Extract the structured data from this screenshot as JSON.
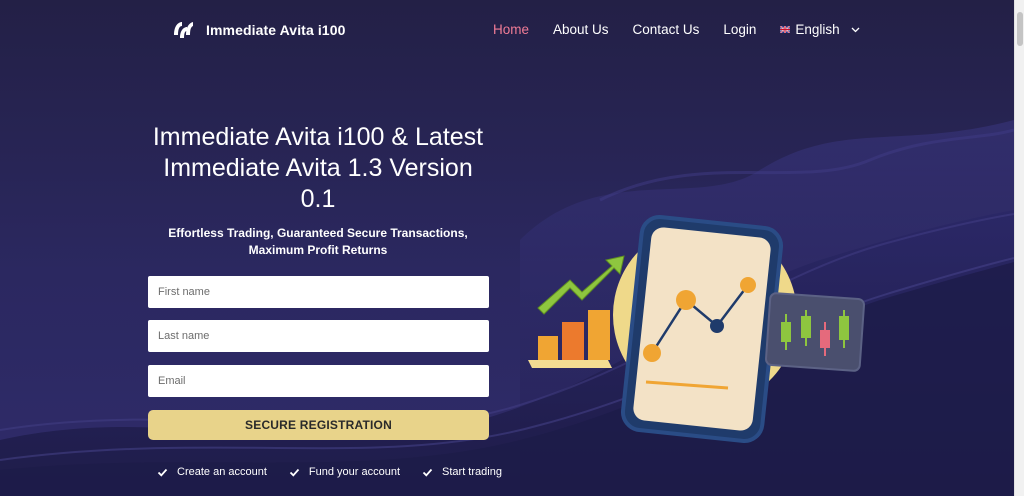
{
  "header": {
    "logo_text": "Immediate Avita i100",
    "nav": [
      {
        "label": "Home",
        "active": true
      },
      {
        "label": "About Us",
        "active": false
      },
      {
        "label": "Contact Us",
        "active": false
      },
      {
        "label": "Login",
        "active": false
      }
    ],
    "language": "English",
    "language_icon": "uk-flag-icon"
  },
  "hero": {
    "title": "Immediate Avita i100 & Latest Immediate Avita 1.3 Version 0.1",
    "subtitle": "Effortless Trading, Guaranteed Secure Transactions, Maximum Profit Returns"
  },
  "form": {
    "first_name_placeholder": "First name",
    "last_name_placeholder": "Last name",
    "email_placeholder": "Email",
    "submit_label": "SECURE REGISTRATION"
  },
  "steps": [
    "Create an account",
    "Fund your account",
    "Start trading"
  ],
  "colors": {
    "background": "#2b2860",
    "nav_active": "#f07c96",
    "button": "#e8d38a",
    "chart_orange": "#f0a533",
    "chart_green": "#8ec63f"
  }
}
